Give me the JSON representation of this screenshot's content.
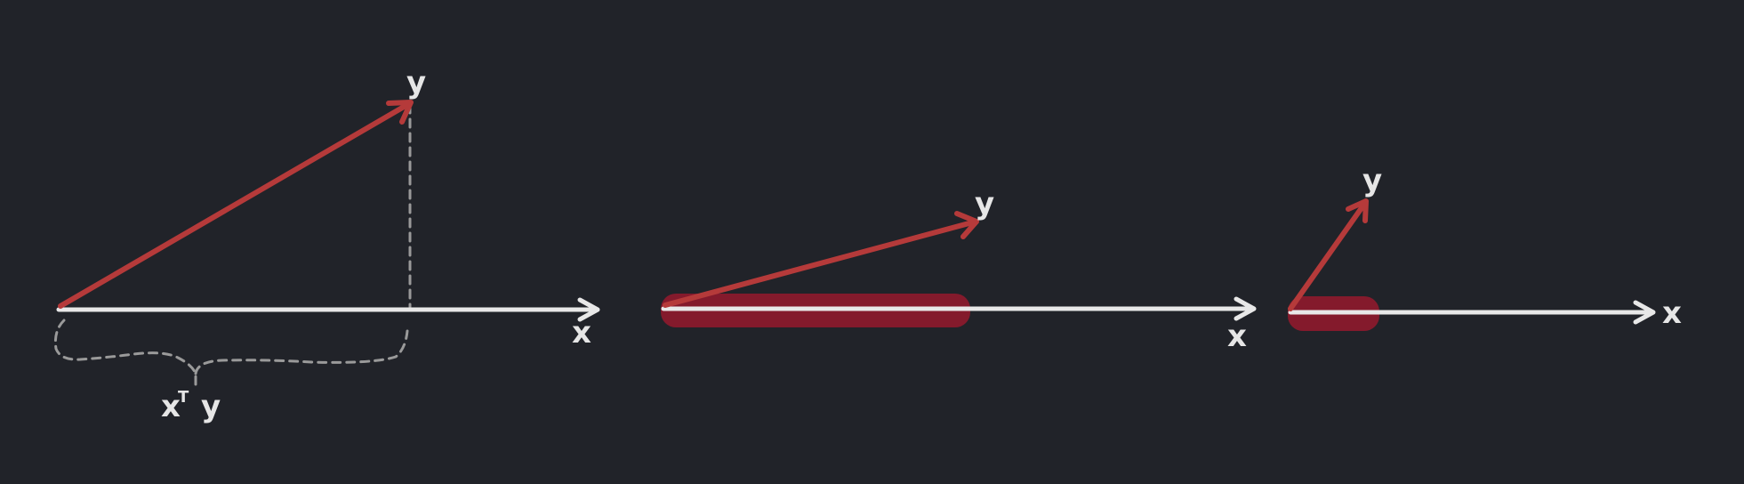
{
  "colors": {
    "background": "#212329",
    "axis": "#e8e8e8",
    "vector": "#b53a3a",
    "projection_highlight": "#8a1a2c",
    "dashed_guide": "#9a9a9a"
  },
  "panels": [
    {
      "x_label": "x",
      "y_label": "y",
      "brace_label_x": "x",
      "brace_label_sup": "T",
      "brace_label_y": "y"
    },
    {
      "x_label": "x",
      "y_label": "y"
    },
    {
      "x_label": "x",
      "y_label": "y"
    }
  ]
}
